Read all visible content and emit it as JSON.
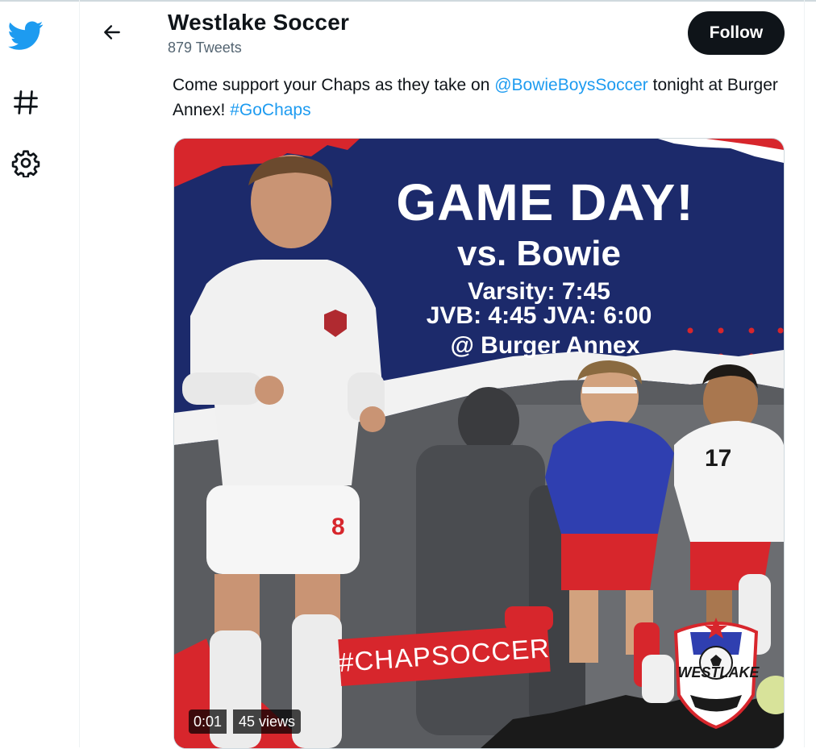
{
  "nav": {
    "items": [
      {
        "icon": "twitter-bird-icon"
      },
      {
        "icon": "hashtag-icon"
      },
      {
        "icon": "gear-icon"
      }
    ]
  },
  "header": {
    "back_icon": "arrow-left-icon",
    "name": "Westlake Soccer",
    "tweet_count": "879 Tweets",
    "follow_label": "Follow"
  },
  "tweet": {
    "text_before": "Come support your Chaps as they take on ",
    "mention": "@BowieBoysSoccer",
    "text_middle": " tonight at Burger Annex! ",
    "hashtag": "#GoChaps"
  },
  "media": {
    "headline": "GAME DAY!",
    "subline": "vs. Bowie",
    "varsity": "Varsity: 7:45",
    "jv_times": "JVB: 4:45 JVA: 6:00",
    "venue": "@ Burger Annex",
    "hashtag_box": "#CHAPSOCCER",
    "crest_text": "WESTLAKE",
    "player_number_1": "8",
    "player_number_2": "17",
    "duration": "0:01",
    "views": "45 views"
  },
  "colors": {
    "brand_blue": "#1d9bf0",
    "poster_navy": "#1c2a6b",
    "poster_red": "#d7262c",
    "follow_bg": "#0f1419"
  }
}
